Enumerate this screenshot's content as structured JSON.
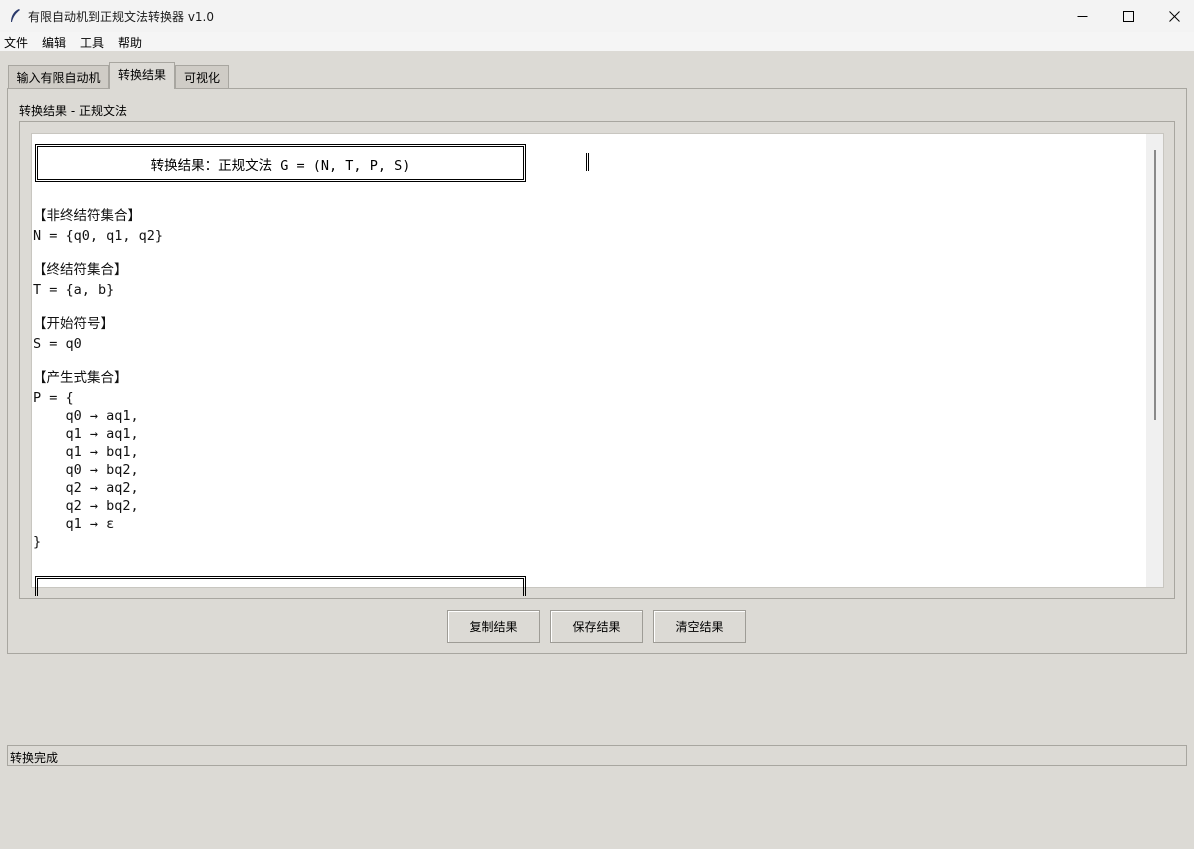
{
  "window": {
    "title": "有限自动机到正规文法转换器 v1.0",
    "minimize_glyph": "—",
    "maximize_glyph": "☐",
    "close_glyph": "✕"
  },
  "menu": [
    "文件",
    "编辑",
    "工具",
    "帮助"
  ],
  "tabs": [
    {
      "label": "输入有限自动机",
      "active": false
    },
    {
      "label": "转换结果",
      "active": true
    },
    {
      "label": "可视化",
      "active": false
    }
  ],
  "result_frame": {
    "label": "转换结果 - 正规文法",
    "header": "转换结果：正规文法 G = (N, T, P, S)",
    "sections": [
      {
        "title": "【非终结符集合】",
        "body": "N = {q0, q1, q2}"
      },
      {
        "title": "【终结符集合】",
        "body": "T = {a, b}"
      },
      {
        "title": "【开始符号】",
        "body": "S = q0"
      },
      {
        "title": "【产生式集合】",
        "body": "P = {"
      }
    ],
    "productions": [
      "    q0 → aq1,",
      "    q1 → aq1,",
      "    q1 → bq1,",
      "    q0 → bq2,",
      "    q2 → aq2,",
      "    q2 → bq2,",
      "    q1 → ε"
    ],
    "closing": "}"
  },
  "buttons": {
    "copy": "复制结果",
    "save": "保存结果",
    "clear": "清空结果"
  },
  "status": "转换完成",
  "colors": {
    "window_bg": "#dcdad5",
    "text_bg": "#ffffff",
    "titlebar_bg": "#f3f3f3",
    "border": "#a8a6a0"
  }
}
